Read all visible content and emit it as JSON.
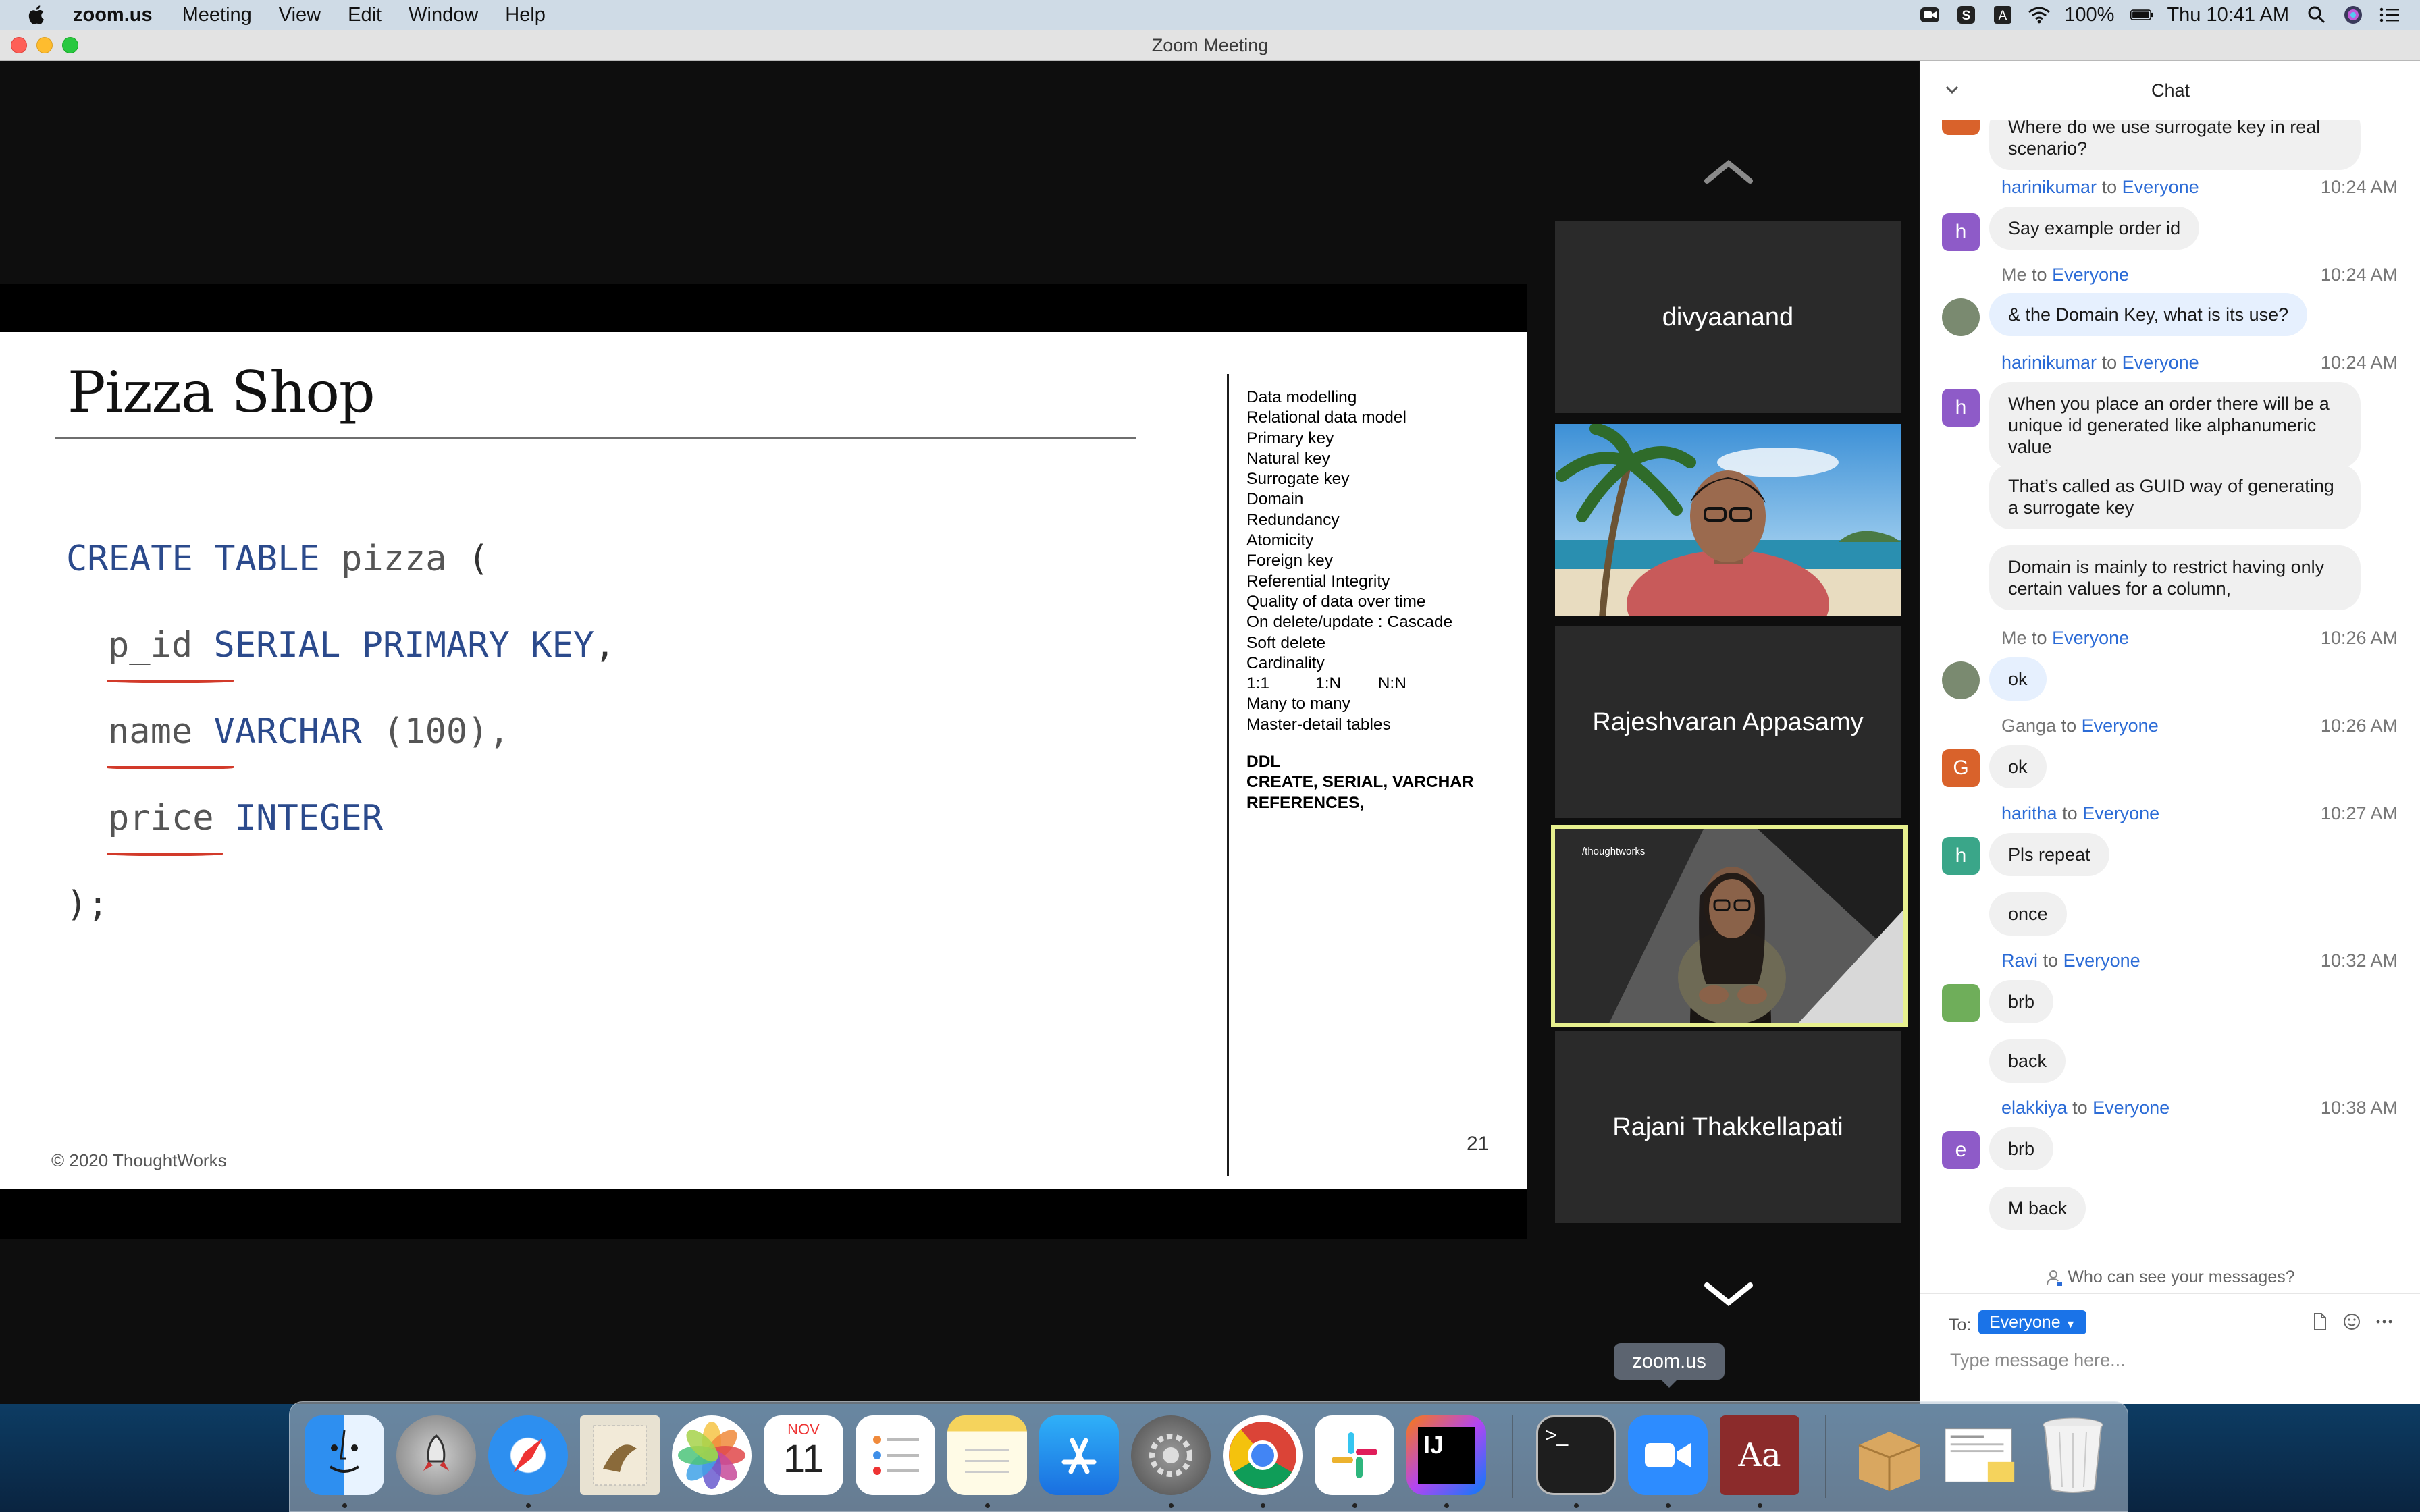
{
  "menubar": {
    "app_name": "zoom.us",
    "menus": [
      "Meeting",
      "View",
      "Edit",
      "Window",
      "Help"
    ],
    "battery": "100%",
    "clock": "Thu 10:41 AM"
  },
  "window": {
    "title": "Zoom Meeting"
  },
  "slide": {
    "title": "Pizza Shop",
    "code": {
      "line1": {
        "kw1": "CREATE",
        "kw2": "TABLE",
        "name": "pizza",
        "open": "("
      },
      "line2": {
        "col": "p_id",
        "type": "SERIAL PRIMARY KEY",
        "end": ","
      },
      "line3": {
        "col": "name",
        "type": "VARCHAR",
        "args": "(100),",
        "end": ""
      },
      "line4": {
        "col": "price",
        "type": "INTEGER"
      },
      "line5": {
        "close": ");"
      }
    },
    "topics": [
      "Data modelling",
      "Relational data model",
      "Primary key",
      "Natural key",
      "Surrogate key",
      "Domain",
      "Redundancy",
      "Atomicity",
      "Foreign key",
      "Referential Integrity",
      "Quality of data over time",
      "On delete/update : Cascade",
      "Soft delete",
      "Cardinality",
      "1:1          1:N        N:N",
      "Many to many",
      "Master-detail tables"
    ],
    "ddl": [
      "DDL",
      "CREATE, SERIAL, VARCHAR",
      "REFERENCES,"
    ],
    "footer": "© 2020 ThoughtWorks",
    "page_number": "21"
  },
  "gallery": {
    "tiles": [
      {
        "name": "divyaanand"
      },
      {
        "name": ""
      },
      {
        "name": "Rajeshvaran Appasamy"
      },
      {
        "name": ""
      },
      {
        "name": "Rajani Thakkellapati"
      }
    ],
    "logo_text": "/thoughtworks"
  },
  "chat": {
    "title": "Chat",
    "to_word": "to",
    "messages": [
      {
        "sender": "",
        "recipient": "",
        "time": "",
        "text": "Where do we use surrogate key in real scenario?"
      },
      {
        "sender": "harinikumar",
        "recipient": "Everyone",
        "time": "10:24 AM",
        "text": "Say example order id"
      },
      {
        "sender": "Me",
        "recipient": "Everyone",
        "time": "10:24 AM",
        "text": "& the Domain Key, what is its use?"
      },
      {
        "sender": "harinikumar",
        "recipient": "Everyone",
        "time": "10:24 AM",
        "text": "When you place an order there will be a unique id generated like alphanumeric value"
      },
      {
        "sender": "",
        "recipient": "",
        "time": "",
        "text": "That’s called as GUID way of generating a surrogate key"
      },
      {
        "sender": "",
        "recipient": "",
        "time": "",
        "text": "Domain is mainly to restrict having only certain values for a column,"
      },
      {
        "sender": "Me",
        "recipient": "Everyone",
        "time": "10:26 AM",
        "text": "ok"
      },
      {
        "sender": "Ganga",
        "recipient": "Everyone",
        "time": "10:26 AM",
        "text": "ok"
      },
      {
        "sender": "haritha",
        "recipient": "Everyone",
        "time": "10:27 AM",
        "text": "Pls repeat"
      },
      {
        "sender": "",
        "recipient": "",
        "time": "",
        "text": "once"
      },
      {
        "sender": "Ravi",
        "recipient": "Everyone",
        "time": "10:32 AM",
        "text": "brb"
      },
      {
        "sender": "",
        "recipient": "",
        "time": "",
        "text": "back"
      },
      {
        "sender": "elakkiya",
        "recipient": "Everyone",
        "time": "10:38 AM",
        "text": "brb"
      },
      {
        "sender": "",
        "recipient": "",
        "time": "",
        "text": "M back"
      }
    ],
    "avatars": {
      "h": "h",
      "G": "G",
      "e": "e"
    },
    "privacy_note": "Who can see your messages?",
    "to_label": "To:",
    "recipient_select": "Everyone",
    "input_placeholder": "Type message here..."
  },
  "dock": {
    "tooltip": "zoom.us",
    "calendar_month": "NOV",
    "calendar_day": "11",
    "dictionary_label": "Aa",
    "intellij_label": "IJ",
    "terminal_label": ">_"
  },
  "colors": {
    "accent": "#1a73e8",
    "active_speaker_border": "#e7f08e",
    "avatar_purple": "#8e5bc8",
    "avatar_orange": "#d9622b",
    "avatar_teal": "#3aa689"
  }
}
